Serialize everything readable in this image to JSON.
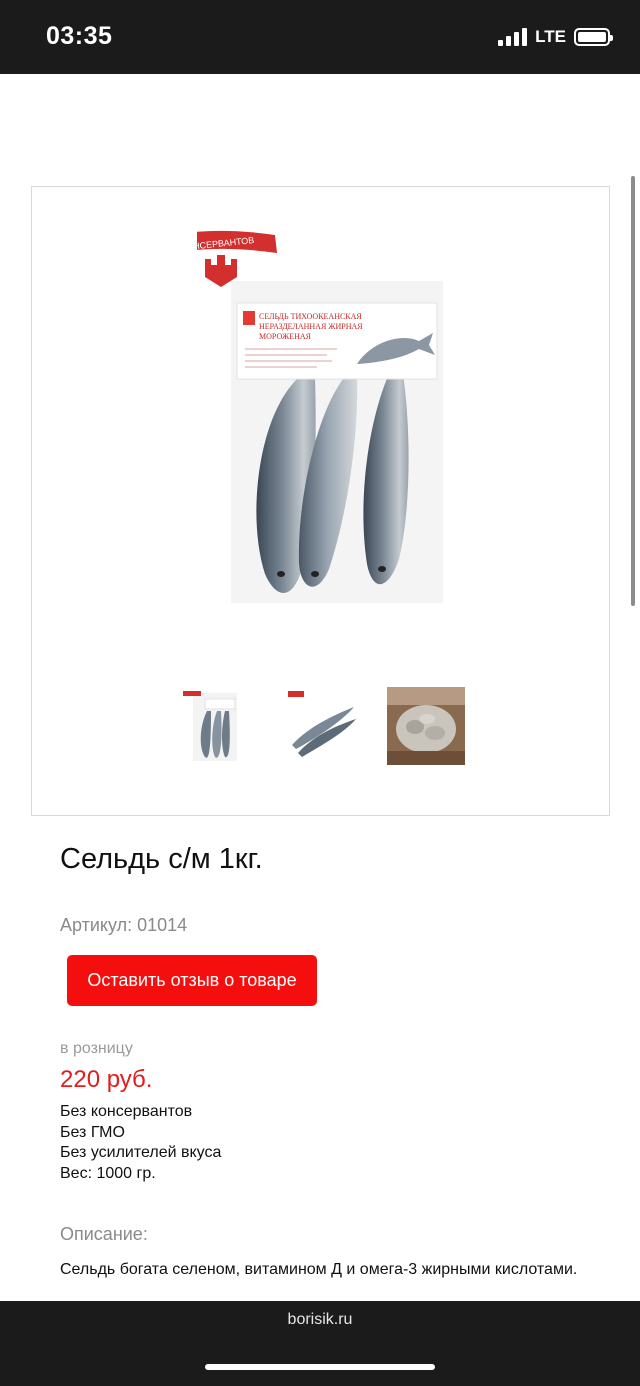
{
  "status": {
    "time": "03:35",
    "network": "LTE"
  },
  "product": {
    "title": "Сельдь с/м 1кг.",
    "sku": "Артикул: 01014",
    "review_button": "Оставить отзыв о товаре",
    "price_label": "в розницу",
    "price": "220 руб.",
    "features": [
      "Без консервантов",
      "Без ГМО",
      "Без усилителей вкуса",
      "Вес: 1000 гр."
    ],
    "description_label": "Описание:",
    "description": "Сельдь богата селеном, витамином Д и омега-3 жирными кислотами."
  },
  "package": {
    "badge": "БЕЗ КОНСЕРВАНТОВ",
    "label_line1": "СЕЛЬДЬ ТИХООКЕАНСКАЯ",
    "label_line2": "НЕРАЗДЕЛАННАЯ ЖИРНАЯ",
    "label_line3": "МОРОЖЕНАЯ"
  },
  "footer": {
    "site": "borisik.ru"
  },
  "colors": {
    "accent": "#f40e0e",
    "price": "#e11d1d",
    "bars": "#1b1b1b"
  }
}
